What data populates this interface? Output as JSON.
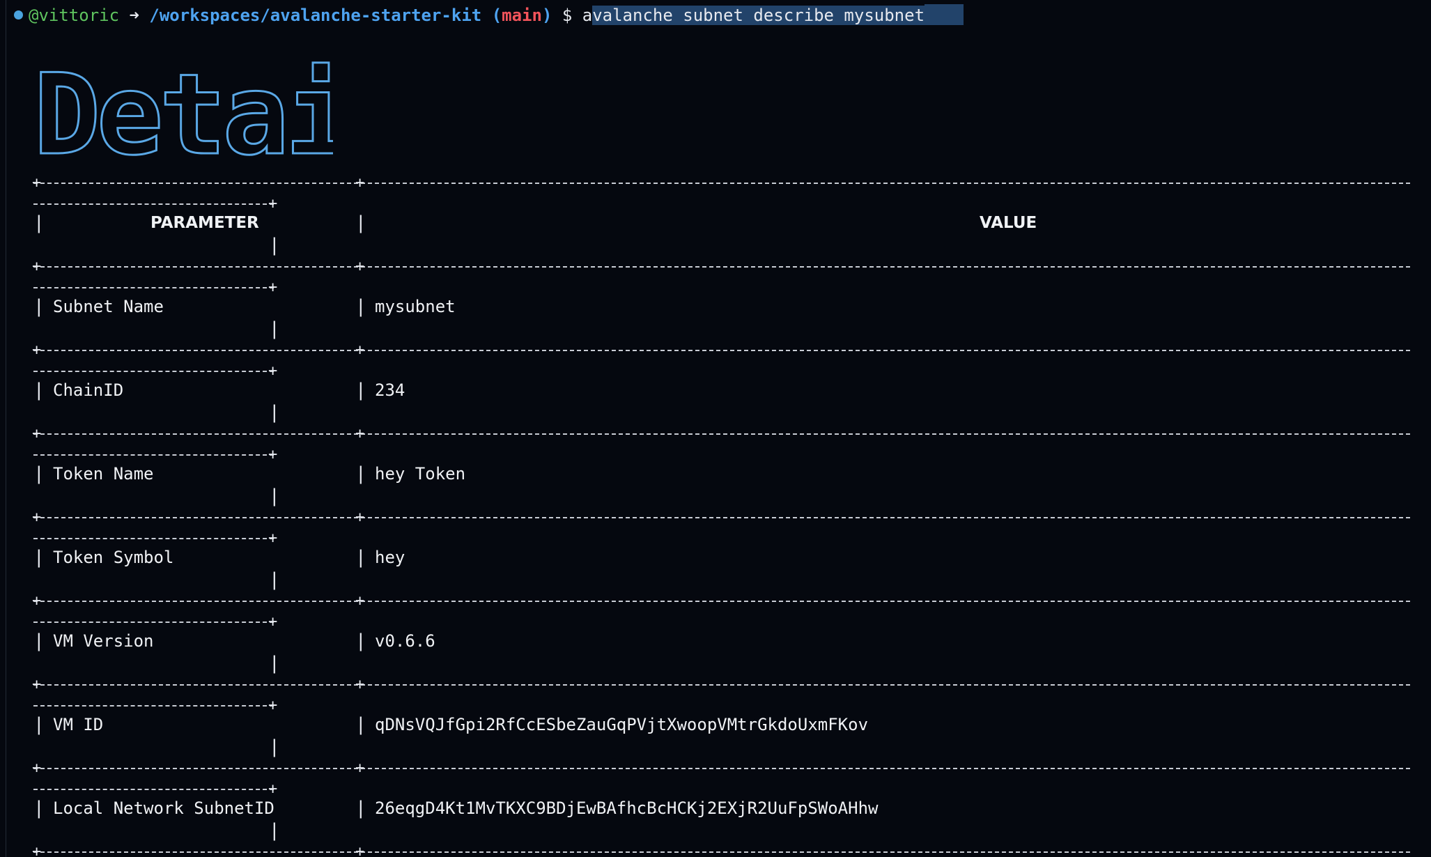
{
  "prompt": {
    "user": "@vittoric",
    "arrow": "➜",
    "path": "/workspaces/avalanche-starter-kit",
    "branch": "main",
    "dollar": "$",
    "command_first": "a",
    "command_rest": "valanche subnet describe mysubnet"
  },
  "banner": {
    "text": "Details"
  },
  "table": {
    "header": {
      "parameter": "PARAMETER",
      "value": "VALUE"
    },
    "rows": [
      {
        "parameter": "Subnet Name",
        "value": "mysubnet"
      },
      {
        "parameter": "ChainID",
        "value": "234"
      },
      {
        "parameter": "Token Name",
        "value": "hey Token"
      },
      {
        "parameter": "Token Symbol",
        "value": "hey"
      },
      {
        "parameter": "VM Version",
        "value": "v0.6.6"
      },
      {
        "parameter": "VM ID",
        "value": "qDNsVQJfGpi2RfCcESbeZauGqPVjtXwoopVMtrGkdoUxmFKov"
      },
      {
        "parameter": "Local Network SubnetID",
        "value": "26eqgD4Kt1MvTKXC9BDjEwBAfhcBcHCKj2EXjR2UuFpSWoAHhw"
      }
    ]
  }
}
